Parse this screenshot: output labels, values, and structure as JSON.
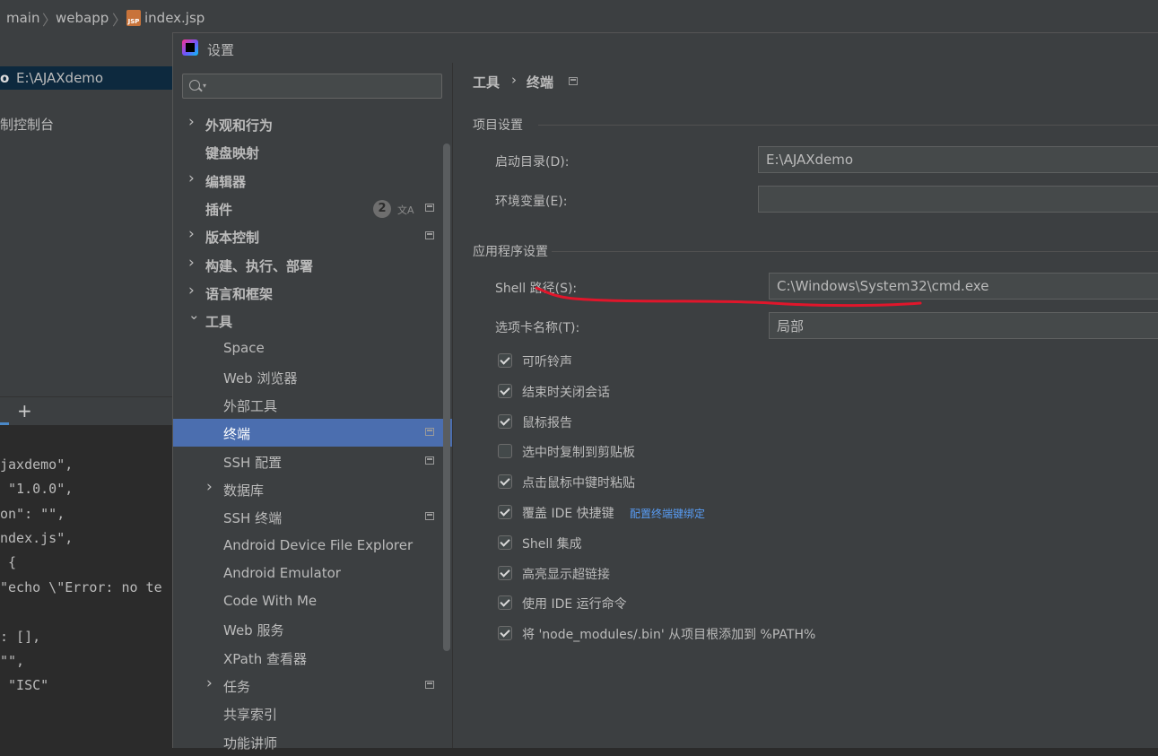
{
  "ide": {
    "breadcrumb": [
      "main",
      "webapp",
      "index.jsp"
    ],
    "file_type_badge": "JSP",
    "project_root": {
      "name": "E:\\AJAXdemo",
      "prefix": "o"
    },
    "tool_window_label": "制控制台",
    "terminal_add_label": "+",
    "code_lines": [
      "jaxdemo\",",
      " \"1.0.0\",",
      "on\": \"\",",
      "ndex.js\",",
      " {",
      "\"echo \\\"Error: no te",
      "",
      ": [],",
      "\"\",",
      " \"ISC\""
    ]
  },
  "dialog": {
    "title": "设置",
    "search": {
      "value": "",
      "placeholder": ""
    },
    "sidebar": [
      {
        "label": "外观和行为",
        "bold": true,
        "expandable": true,
        "expanded": false,
        "level": 0
      },
      {
        "label": "键盘映射",
        "bold": true,
        "expandable": false,
        "level": 0
      },
      {
        "label": "编辑器",
        "bold": true,
        "expandable": true,
        "expanded": false,
        "level": 0
      },
      {
        "label": "插件",
        "bold": true,
        "expandable": false,
        "level": 0,
        "badge": "2",
        "translate": true,
        "project_icon": true
      },
      {
        "label": "版本控制",
        "bold": true,
        "expandable": true,
        "expanded": false,
        "level": 0,
        "project_icon": true
      },
      {
        "label": "构建、执行、部署",
        "bold": true,
        "expandable": true,
        "expanded": false,
        "level": 0
      },
      {
        "label": "语言和框架",
        "bold": true,
        "expandable": true,
        "expanded": false,
        "level": 0
      },
      {
        "label": "工具",
        "bold": true,
        "expandable": true,
        "expanded": true,
        "level": 0
      },
      {
        "label": "Space",
        "level": 1
      },
      {
        "label": "Web 浏览器",
        "level": 1
      },
      {
        "label": "外部工具",
        "level": 1
      },
      {
        "label": "终端",
        "level": 1,
        "selected": true,
        "project_icon": true
      },
      {
        "label": "SSH 配置",
        "level": 1,
        "project_icon": true
      },
      {
        "label": "数据库",
        "level": 1,
        "expandable": true,
        "expanded": false
      },
      {
        "label": "SSH 终端",
        "level": 1,
        "project_icon": true
      },
      {
        "label": "Android Device File Explorer",
        "level": 1
      },
      {
        "label": "Android Emulator",
        "level": 1
      },
      {
        "label": "Code With Me",
        "level": 1
      },
      {
        "label": "Web 服务",
        "level": 1
      },
      {
        "label": "XPath 查看器",
        "level": 1
      },
      {
        "label": "任务",
        "level": 1,
        "expandable": true,
        "expanded": false,
        "project_icon": true
      },
      {
        "label": "共享索引",
        "level": 1
      },
      {
        "label": "功能讲师",
        "level": 1
      }
    ],
    "content": {
      "breadcrumb": {
        "parent": "工具",
        "separator": "›",
        "current": "终端"
      },
      "project_settings": {
        "title": "项目设置",
        "start_dir": {
          "label": "启动目录(D):",
          "value": "E:\\AJAXdemo"
        },
        "env_vars": {
          "label": "环境变量(E):",
          "value": ""
        }
      },
      "app_settings": {
        "title": "应用程序设置",
        "shell_path": {
          "label": "Shell 路径(S):",
          "value": "C:\\Windows\\System32\\cmd.exe"
        },
        "tab_name": {
          "label": "选项卡名称(T):",
          "value": "局部"
        },
        "options": [
          {
            "label": "可听铃声",
            "checked": true
          },
          {
            "label": "结束时关闭会话",
            "checked": true
          },
          {
            "label": "鼠标报告",
            "checked": true
          },
          {
            "label": "选中时复制到剪贴板",
            "checked": false
          },
          {
            "label": "点击鼠标中键时粘贴",
            "checked": true
          },
          {
            "label": "覆盖 IDE 快捷键",
            "checked": true,
            "link": "配置终端键绑定"
          },
          {
            "label": "Shell 集成",
            "checked": true
          },
          {
            "label": "高亮显示超链接",
            "checked": true
          },
          {
            "label": "使用 IDE 运行命令",
            "checked": true
          },
          {
            "label": "将 'node_modules/.bin' 从项目根添加到 %PATH%",
            "checked": true
          }
        ]
      }
    }
  },
  "colors": {
    "selection": "#4b6eaf",
    "annotation": "#e0162b",
    "link": "#589df6"
  }
}
